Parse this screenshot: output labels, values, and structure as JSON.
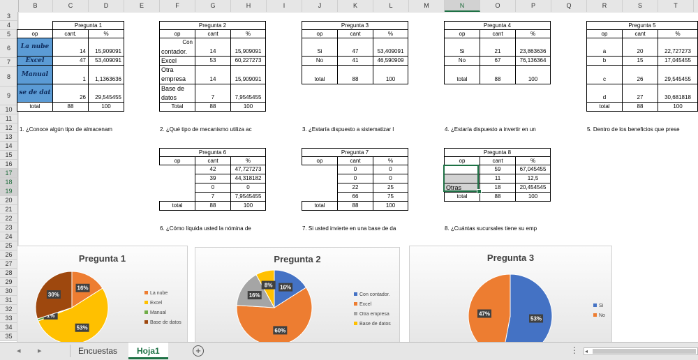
{
  "columns": [
    "B",
    "C",
    "D",
    "E",
    "F",
    "G",
    "H",
    "I",
    "J",
    "K",
    "L",
    "M",
    "N",
    "O",
    "P",
    "Q",
    "R",
    "S",
    "T"
  ],
  "selected_column": "N",
  "rows": [
    "3",
    "4",
    "5",
    "6",
    "7",
    "8",
    "9",
    "10",
    "11",
    "12",
    "13",
    "14",
    "15",
    "16",
    "17",
    "18",
    "19",
    "20",
    "21",
    "22",
    "23",
    "24",
    "25",
    "26",
    "27",
    "28",
    "29",
    "30",
    "31",
    "32",
    "33",
    "34",
    "35"
  ],
  "selected_rows": [
    "17",
    "18",
    "19"
  ],
  "p1": {
    "title": "Pregunta 1",
    "h_op": "op",
    "h_cant": "cant.",
    "h_pct": "%",
    "r1": {
      "op": "La nube",
      "cant": "14",
      "pct": "15,909091"
    },
    "r2": {
      "op": "Excel",
      "cant": "47",
      "pct": "53,409091"
    },
    "r3": {
      "op": "Manual",
      "cant": "1",
      "pct": "1,1363636"
    },
    "r4": {
      "op": "se de dat",
      "cant": "26",
      "pct": "29,545455"
    },
    "total": {
      "op": "total",
      "cant": "88",
      "pct": "100"
    }
  },
  "p2": {
    "title": "Pregunta 2",
    "h_op": "op",
    "h_cant": "cant",
    "h_pct": "%",
    "r1a": "Con",
    "r1b": "contador.",
    "r1c": "14",
    "r1p": "15,909091",
    "r2": "Excel",
    "r2c": "53",
    "r2p": "60,227273",
    "r3a": "Otra",
    "r3b": "empresa",
    "r3c": "14",
    "r3p": "15,909091",
    "r4a": "Base  de",
    "r4b": "datos",
    "r4c": "7",
    "r4p": "7,9545455",
    "total": "Total",
    "tc": "88",
    "tp": "100"
  },
  "p3": {
    "title": "Pregunta 3",
    "h_op": "op",
    "h_cant": "cant",
    "h_pct": "%",
    "r1": "Si",
    "r1c": "47",
    "r1p": "53,409091",
    "r2": "No",
    "r2c": "41",
    "r2p": "46,590909",
    "total": "total",
    "tc": "88",
    "tp": "100"
  },
  "p4": {
    "title": "Pregunta 4",
    "h_op": "op",
    "h_cant": "cant",
    "h_pct": "%",
    "r1": "Si",
    "r1c": "21",
    "r1p": "23,863636",
    "r2": "No",
    "r2c": "67",
    "r2p": "76,136364",
    "total": "total",
    "tc": "88",
    "tp": "100"
  },
  "p5": {
    "title": "Pregunta 5",
    "h_op": "op",
    "h_cant": "cant",
    "h_pct": "%",
    "r1": "a",
    "r1c": "20",
    "r1p": "22,727273",
    "r2": "b",
    "r2c": "15",
    "r2p": "17,045455",
    "r3": "c",
    "r3c": "26",
    "r3p": "29,545455",
    "r4": "d",
    "r4c": "27",
    "r4p": "30,681818",
    "total": "total",
    "tc": "88",
    "tp": "100"
  },
  "questions": {
    "q1": "1. ¿Conoce algún tipo de almacenam",
    "q2": "2. ¿Qué tipo de mecanismo utiliza ac",
    "q3": "3. ¿Estaría dispuesto a sistematizar l",
    "q4": "4. ¿Estaría dispuesto a invertir en un",
    "q5": "5. Dentro de los beneficios que prese",
    "q6": "6. ¿Cómo líquida usted la nómina de",
    "q7": "7. Si usted invierte en una base de da",
    "q8": "8. ¿Cuántas sucursales tiene su emp"
  },
  "p6": {
    "title": "Pregunta 6",
    "h_op": "op",
    "h_cant": "cant",
    "h_pct": "%",
    "v": [
      [
        "42",
        "47,727273"
      ],
      [
        "39",
        "44,318182"
      ],
      [
        "0",
        "0"
      ],
      [
        "7",
        "7,9545455"
      ]
    ],
    "total": "total",
    "tc": "88",
    "tp": "100"
  },
  "p7": {
    "title": "Pregunta 7",
    "h_op": "op",
    "h_cant": "cant",
    "h_pct": "%",
    "v": [
      [
        "0",
        "0"
      ],
      [
        "0",
        "0"
      ],
      [
        "22",
        "25"
      ],
      [
        "66",
        "75"
      ]
    ],
    "total": "total",
    "tc": "88",
    "tp": "100"
  },
  "p8": {
    "title": "Pregunta 8",
    "h_op": "op",
    "h_cant": "cant",
    "h_pct": "%",
    "v": [
      [
        "",
        "59",
        "67,045455"
      ],
      [
        "",
        "11",
        "12,5"
      ],
      [
        "Otras",
        "18",
        "20,454545"
      ]
    ],
    "total": "total",
    "tc": "88",
    "tp": "100"
  },
  "chart_data": [
    {
      "type": "pie",
      "title": "Pregunta 1",
      "categories": [
        "La nube",
        "Excel",
        "Manual",
        "Base de datos"
      ],
      "values": [
        16,
        53,
        1,
        30
      ],
      "colors": [
        "#ed7d31",
        "#ffc000",
        "#70ad47",
        "#9e480e"
      ]
    },
    {
      "type": "pie",
      "title": "Pregunta 2",
      "categories": [
        "Con contador.",
        "Excel",
        "Otra empresa",
        "Base de datos"
      ],
      "values": [
        16,
        60,
        16,
        8
      ],
      "colors": [
        "#4472c4",
        "#ed7d31",
        "#a5a5a5",
        "#ffc000"
      ]
    },
    {
      "type": "pie",
      "title": "Pregunta 3",
      "categories": [
        "Si",
        "No"
      ],
      "values": [
        53,
        47
      ],
      "colors": [
        "#4472c4",
        "#ed7d31"
      ]
    }
  ],
  "tabs": {
    "t1": "Encuestas",
    "t2": "Hoja1"
  },
  "colors": {
    "accent": "#1e7145",
    "cell_image": "#5b9bd5"
  }
}
